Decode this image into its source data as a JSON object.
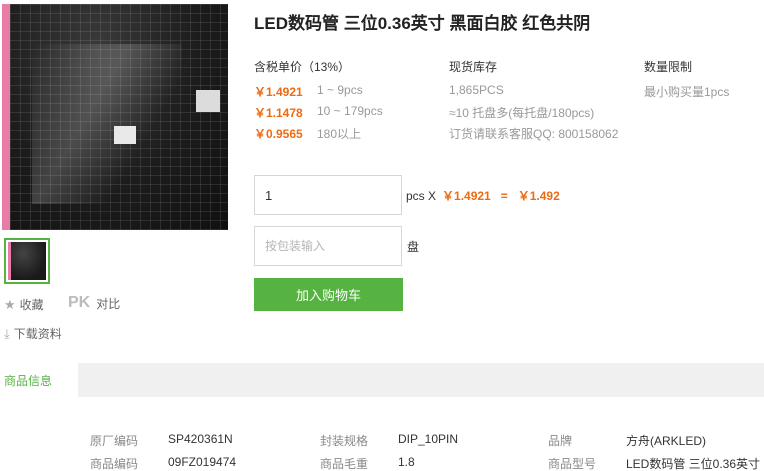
{
  "product": {
    "title": "LED数码管 三位0.36英寸 黑面白胶 红色共阴"
  },
  "gallery": {
    "actions": {
      "favorite_label": "收藏",
      "pk_label": "PK",
      "compare_label": "对比",
      "download_label": "下载资料"
    }
  },
  "pricing": {
    "header": "含税单价（13%）",
    "tiers": [
      {
        "price": "￥1.4921",
        "qty": "1 ~ 9pcs"
      },
      {
        "price": "￥1.1478",
        "qty": "10 ~ 179pcs"
      },
      {
        "price": "￥0.9565",
        "qty": "180以上"
      }
    ]
  },
  "stock": {
    "header": "现货库存",
    "lines": [
      "1,865PCS",
      "≈10 托盘多(每托盘/180pcs)",
      "订货请联系客服QQ: 800158062"
    ]
  },
  "limit": {
    "header": "数量限制",
    "text": "最小购买量1pcs"
  },
  "order": {
    "qty_value": "1",
    "unit_text": "pcs X",
    "unit_price": "￥1.4921",
    "equals": "=",
    "total": "￥1.492",
    "pack_placeholder": "按包装输入",
    "pack_unit": "盘",
    "add_to_cart": "加入购物车"
  },
  "info": {
    "tab_label": "商品信息",
    "specs": [
      {
        "label": "原厂编码",
        "value": "SP420361N"
      },
      {
        "label": "封装规格",
        "value": "DIP_10PIN"
      },
      {
        "label": "品牌",
        "value": "方舟(ARKLED)"
      },
      {
        "label": "商品编码",
        "value": "09FZ019474"
      },
      {
        "label": "商品毛重",
        "value": "1.8"
      },
      {
        "label": "商品型号",
        "value": "LED数码管 三位0.36英寸"
      }
    ]
  },
  "colors": {
    "accent_green": "#56b342",
    "price_orange": "#f06a11"
  }
}
